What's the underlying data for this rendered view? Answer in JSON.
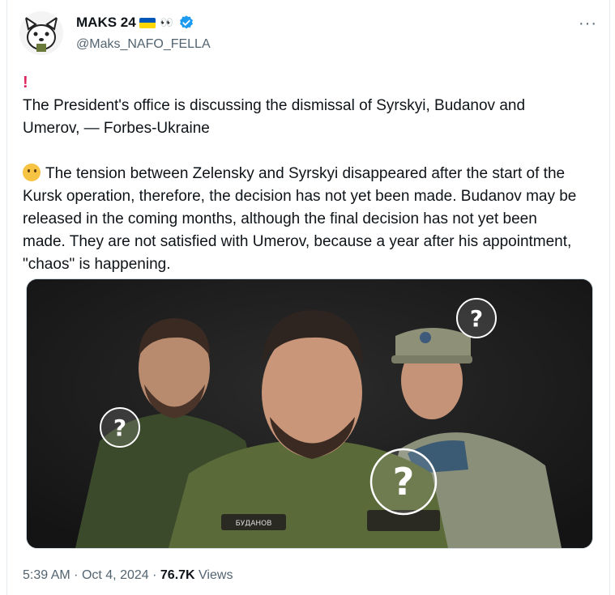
{
  "author": {
    "display_name": "MAKS 24",
    "handle": "@Maks_NAFO_FELLA"
  },
  "tweet": {
    "paragraph1": "The President's office is discussing the dismissal of Syrskyi, Budanov and Umerov, — Forbes-Ukraine",
    "paragraph2": "The tension between Zelensky and Syrskyi disappeared after the start of the Kursk operation, therefore, the decision has not yet been made. Budanov may be released in the coming months, although the final decision has not yet been made. They are not satisfied with Umerov, because a year after his appointment, \"chaos\" is happening."
  },
  "media": {
    "badge_center": "БУДАНОВ"
  },
  "meta": {
    "time": "5:39 AM",
    "date": "Oct 4, 2024",
    "views_count": "76.7K",
    "views_label": "Views"
  },
  "colors": {
    "verified": "#1d9bf0",
    "flag_blue": "#0057b7",
    "flag_yellow": "#ffd700"
  },
  "icons": {
    "more": "more-options-icon",
    "verified": "verified-badge-icon",
    "question": "question-mark-icon"
  }
}
